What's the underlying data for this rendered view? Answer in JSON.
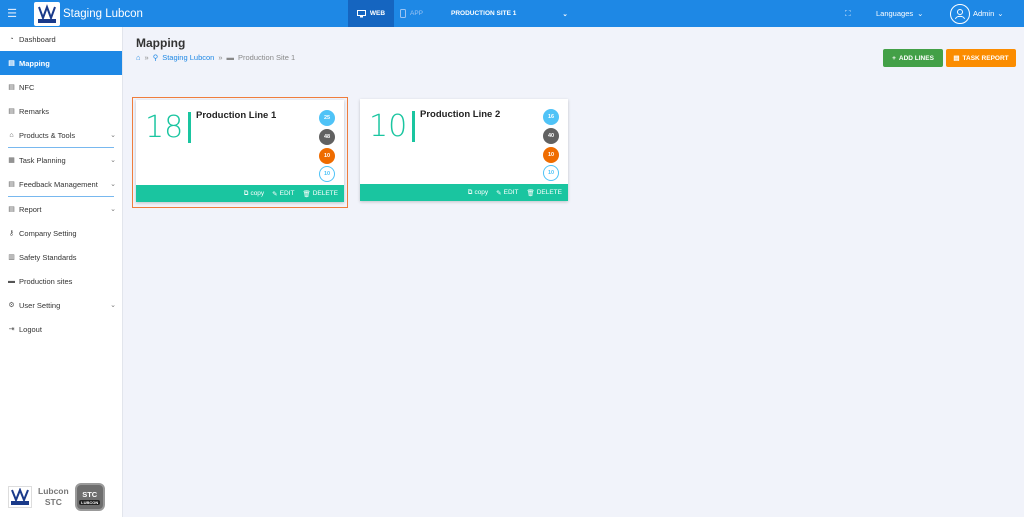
{
  "topbar": {
    "brand_name": "Staging Lubcon",
    "tab_web": "WEB",
    "tab_app": "APP",
    "site": "PRODUCTION SITE 1",
    "languages": "Languages",
    "user": "Admin"
  },
  "sidebar": {
    "items": [
      {
        "label": "Dashboard",
        "icon": "dashboard-icon"
      },
      {
        "label": "Mapping",
        "icon": "map-icon"
      },
      {
        "label": "NFC",
        "icon": "nfc-icon"
      },
      {
        "label": "Remarks",
        "icon": "remarks-icon"
      },
      {
        "label": "Products & Tools",
        "icon": "tools-icon"
      },
      {
        "label": "Task Planning",
        "icon": "calendar-icon"
      },
      {
        "label": "Feedback Management",
        "icon": "feedback-icon"
      },
      {
        "label": "Report",
        "icon": "report-icon"
      },
      {
        "label": "Company Setting",
        "icon": "key-icon"
      },
      {
        "label": "Safety Standards",
        "icon": "safety-icon"
      },
      {
        "label": "Production sites",
        "icon": "briefcase-icon"
      },
      {
        "label": "User Setting",
        "icon": "users-icon"
      },
      {
        "label": "Logout",
        "icon": "logout-icon"
      }
    ],
    "footer": {
      "brand": "Lubcon STC",
      "line1": "Lubcon",
      "line2": "STC",
      "badge": "STC",
      "badge_sub": "LUBCON"
    }
  },
  "page": {
    "title": "Mapping",
    "breadcrumb": [
      "Staging Lubcon",
      "Production Site 1"
    ],
    "add_lines": "ADD LINES",
    "task_report": "TASK REPORT"
  },
  "cards": [
    {
      "number": "18",
      "title": "Production Line 1",
      "badges": [
        "25",
        "48",
        "10",
        "10"
      ],
      "copy": "copy",
      "edit": "EDIT",
      "delete": "DELETE"
    },
    {
      "number": "10",
      "title": "Production Line 2",
      "badges": [
        "16",
        "40",
        "10",
        "10"
      ],
      "copy": "copy",
      "edit": "EDIT",
      "delete": "DELETE"
    }
  ],
  "colors": {
    "primary": "#1e88e5",
    "accent": "#1ac5a0",
    "add": "#43a047",
    "report": "#fb8c00"
  }
}
